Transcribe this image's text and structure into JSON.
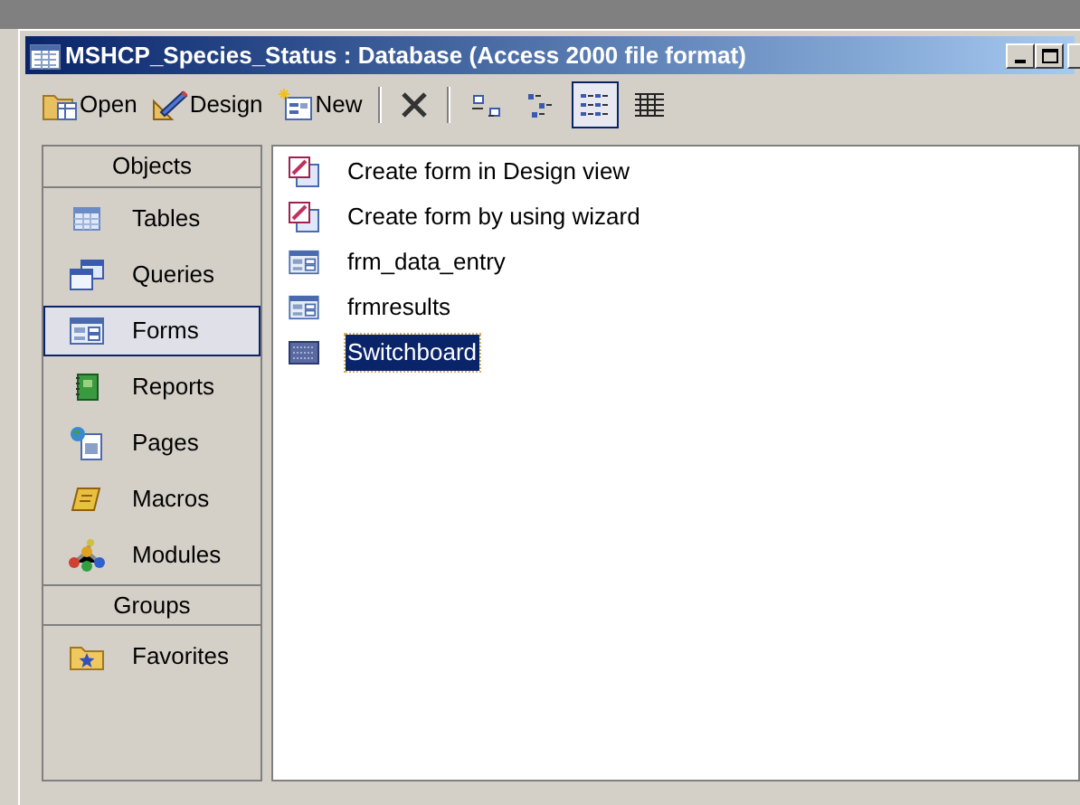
{
  "window": {
    "title": "MSHCP_Species_Status : Database (Access 2000 file format)"
  },
  "toolbar": {
    "buttons": [
      {
        "label": "Open",
        "kind": "open"
      },
      {
        "label": "Design",
        "kind": "design"
      },
      {
        "label": "New",
        "kind": "new"
      }
    ],
    "views": [
      {
        "kind": "large",
        "selected": false
      },
      {
        "kind": "small",
        "selected": false
      },
      {
        "kind": "list",
        "selected": true
      },
      {
        "kind": "details",
        "selected": false
      }
    ]
  },
  "sidebar": {
    "sections": [
      {
        "heading": "Objects",
        "items": [
          {
            "label": "Tables",
            "kind": "tables",
            "selected": false
          },
          {
            "label": "Queries",
            "kind": "queries",
            "selected": false
          },
          {
            "label": "Forms",
            "kind": "forms",
            "selected": true
          },
          {
            "label": "Reports",
            "kind": "reports",
            "selected": false
          },
          {
            "label": "Pages",
            "kind": "pages",
            "selected": false
          },
          {
            "label": "Macros",
            "kind": "macros",
            "selected": false
          },
          {
            "label": "Modules",
            "kind": "modules",
            "selected": false
          }
        ]
      },
      {
        "heading": "Groups",
        "items": [
          {
            "label": "Favorites",
            "kind": "favorites",
            "selected": false
          }
        ]
      }
    ]
  },
  "list": {
    "items": [
      {
        "label": "Create form in Design view",
        "kind": "shortcut",
        "selected": false
      },
      {
        "label": "Create form by using wizard",
        "kind": "shortcut",
        "selected": false
      },
      {
        "label": "frm_data_entry",
        "kind": "form",
        "selected": false
      },
      {
        "label": "frmresults",
        "kind": "form",
        "selected": false
      },
      {
        "label": "Switchboard",
        "kind": "switchboard",
        "selected": true
      }
    ]
  }
}
